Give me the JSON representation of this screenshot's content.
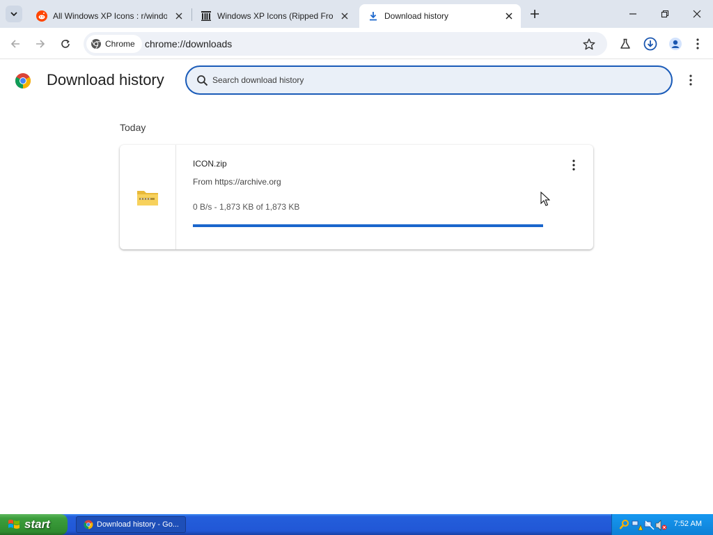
{
  "tabs": [
    {
      "title": "All Windows XP Icons : r/windo",
      "favicon": "reddit-icon"
    },
    {
      "title": "Windows XP Icons (Ripped From",
      "favicon": "archive-org-icon"
    },
    {
      "title": "Download history",
      "favicon": "download-icon"
    }
  ],
  "toolbar": {
    "chip_label": "Chrome",
    "url": "chrome://downloads"
  },
  "page": {
    "title": "Download history",
    "search_placeholder": "Search download history",
    "section_label": "Today"
  },
  "download": {
    "filename": "ICON.zip",
    "source": "From https://archive.org",
    "status": "0 B/s - 1,873 KB of 1,873 KB",
    "progress": 1.0
  },
  "taskbar": {
    "start_label": "start",
    "task_label": "Download history - Go...",
    "clock": "7:52 AM"
  },
  "colors": {
    "accent": "#1a66cc",
    "search_border": "#1a5bb8",
    "taskbar_blue": "#245edb",
    "start_green": "#3c9e3c"
  }
}
